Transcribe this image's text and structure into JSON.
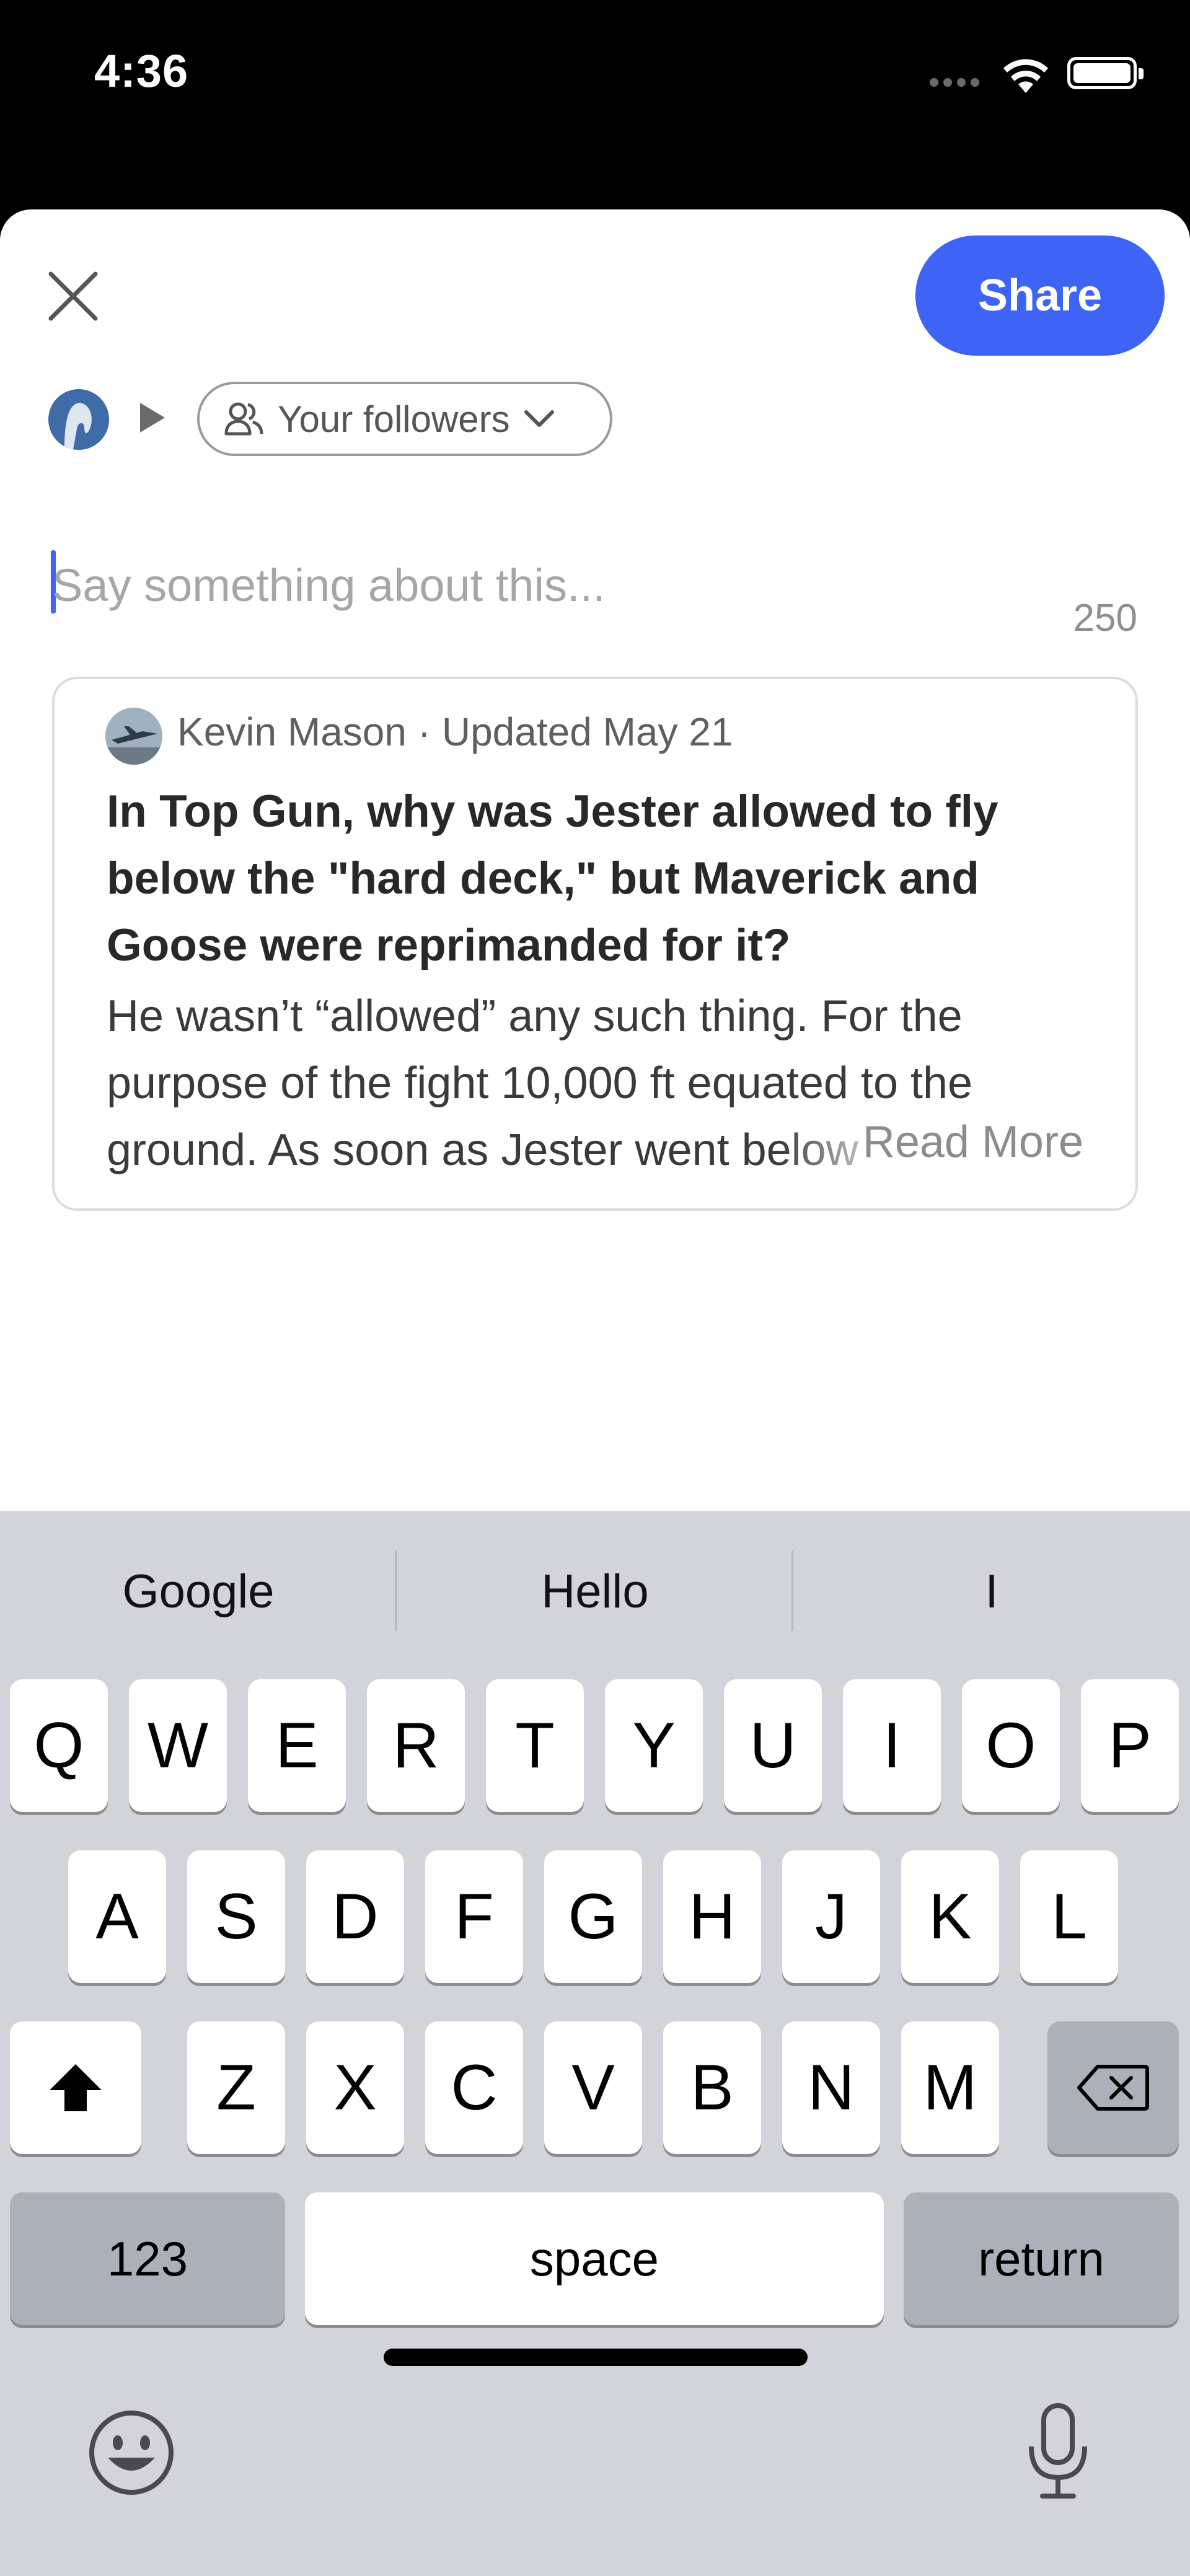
{
  "status_bar": {
    "time": "4:36"
  },
  "header": {
    "share_label": "Share",
    "audience_label": "Your followers"
  },
  "compose": {
    "placeholder": "Say something about this...",
    "char_count": "250"
  },
  "quoted_post": {
    "meta": "Kevin Mason · Updated May 21",
    "title": "In Top Gun, why was Jester allowed to fly below the \"hard deck,\" but Maverick and Goose were reprimanded for it?",
    "body": "He wasn’t “allowed” any such thing. For the purpose of the fight 10,000 ft equated to the ground. As soon as Jester went below the hard deck he was as good as dead.",
    "read_more": "Read More"
  },
  "keyboard": {
    "suggestions": [
      "Google",
      "Hello",
      "I"
    ],
    "row1": [
      "Q",
      "W",
      "E",
      "R",
      "T",
      "Y",
      "U",
      "I",
      "O",
      "P"
    ],
    "row2": [
      "A",
      "S",
      "D",
      "F",
      "G",
      "H",
      "J",
      "K",
      "L"
    ],
    "row3": [
      "Z",
      "X",
      "C",
      "V",
      "B",
      "N",
      "M"
    ],
    "numbers_label": "123",
    "space_label": "space",
    "return_label": "return"
  },
  "colors": {
    "accent": "#3d64f4",
    "keyboard_bg": "#d2d4d9"
  },
  "icons": [
    "close-icon",
    "avatar",
    "play-arrow-icon",
    "followers-icon",
    "chevron-down-icon",
    "shift-icon",
    "backspace-icon",
    "emoji-icon",
    "microphone-icon"
  ]
}
